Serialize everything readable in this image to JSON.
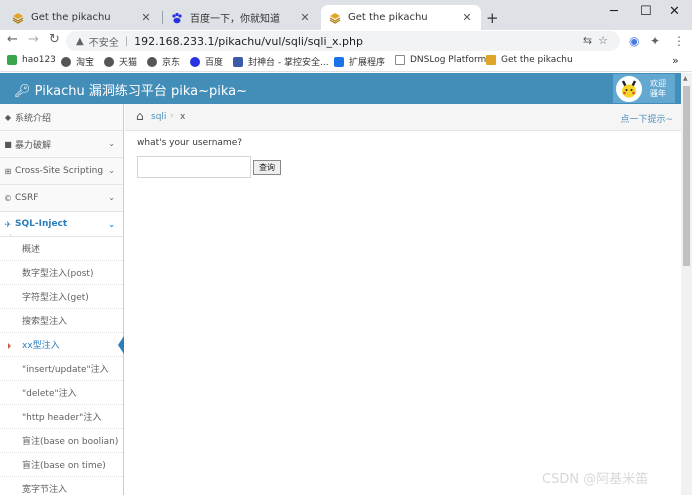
{
  "browser": {
    "tabs": [
      {
        "title": "Get the pikachu"
      },
      {
        "title": "百度一下，你就知道"
      },
      {
        "title": "Get the pikachu"
      }
    ],
    "new_tab_label": "+",
    "insecure_label": "不安全",
    "url": "192.168.233.1/pikachu/vul/sqli/sqli_x.php",
    "bookmarks": [
      {
        "label": "hao123"
      },
      {
        "label": "淘宝"
      },
      {
        "label": "天猫"
      },
      {
        "label": "京东"
      },
      {
        "label": "百度"
      },
      {
        "label": "封神台 - 掌控安全..."
      },
      {
        "label": "扩展程序"
      },
      {
        "label": "DNSLog Platform"
      },
      {
        "label": "Get the pikachu"
      }
    ],
    "more_bookmarks": "»"
  },
  "header": {
    "brand": "Pikachu 漏洞练习平台 pika~pika~",
    "welcome_line1": "欢迎",
    "welcome_line2": "骚年"
  },
  "sidebar": {
    "items": [
      {
        "label": "系统介绍"
      },
      {
        "label": "暴力破解"
      },
      {
        "label": "Cross-Site Scripting"
      },
      {
        "label": "CSRF"
      },
      {
        "label": "SQL-Inject"
      }
    ],
    "sub_items": [
      {
        "label": "概述"
      },
      {
        "label": "数字型注入(post)"
      },
      {
        "label": "字符型注入(get)"
      },
      {
        "label": "搜索型注入"
      },
      {
        "label": "xx型注入"
      },
      {
        "label": "\"insert/update\"注入"
      },
      {
        "label": "\"delete\"注入"
      },
      {
        "label": "\"http header\"注入"
      },
      {
        "label": "盲注(base on boolian)"
      },
      {
        "label": "盲注(base on time)"
      },
      {
        "label": "宽字节注入"
      }
    ]
  },
  "main": {
    "breadcrumb_link": "sqli",
    "breadcrumb_sep": "›",
    "breadcrumb_current": "x",
    "hint_link": "点一下提示~",
    "question": "what's your username?",
    "username_value": "",
    "submit_label": "查询"
  },
  "watermark": "CSDN @阿基米笛",
  "colors": {
    "header_bg": "#438eb9",
    "active_link": "#2b7dbc"
  }
}
